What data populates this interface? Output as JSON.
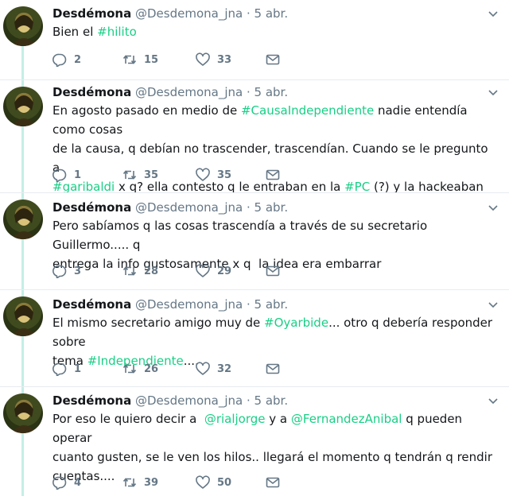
{
  "colors": {
    "accent": "#19cf86",
    "thread_line": "#c4eee6",
    "muted": "#657786"
  },
  "tweets": [
    {
      "name": "Desdémona",
      "handle": "@Desdemona_jna",
      "dot": "·",
      "time": "5 abr.",
      "segments": [
        {
          "t": "Bien el "
        },
        {
          "t": "#hilito",
          "k": "hashtag"
        }
      ],
      "replies": "2",
      "retweets": "15",
      "likes": "33"
    },
    {
      "name": "Desdémona",
      "handle": "@Desdemona_jna",
      "dot": "·",
      "time": "5 abr.",
      "segments": [
        {
          "t": "En agosto pasado en medio de "
        },
        {
          "t": "#CausaIndependiente",
          "k": "hashtag"
        },
        {
          "t": " nadie entendía como cosas\nde la causa, q debían no trascender, trascendían. Cuando se le pregunto a\n"
        },
        {
          "t": "#garibaldi",
          "k": "hashtag"
        },
        {
          "t": " x q? ella contesto q le entraban en la "
        },
        {
          "t": "#PC",
          "k": "hashtag"
        },
        {
          "t": " (?) y la hackeaban"
        }
      ],
      "replies": "1",
      "retweets": "35",
      "likes": "35"
    },
    {
      "name": "Desdémona",
      "handle": "@Desdemona_jna",
      "dot": "·",
      "time": "5 abr.",
      "segments": [
        {
          "t": "Pero sabíamos q las cosas trascendía a través de su secretario Guillermo..... q\nentrega la info gustosamente x q  la idea era embarrar"
        }
      ],
      "replies": "3",
      "retweets": "28",
      "likes": "29"
    },
    {
      "name": "Desdémona",
      "handle": "@Desdemona_jna",
      "dot": "·",
      "time": "5 abr.",
      "segments": [
        {
          "t": "El mismo secretario amigo muy de "
        },
        {
          "t": "#Oyarbide",
          "k": "hashtag"
        },
        {
          "t": "... otro q debería responder sobre\ntema "
        },
        {
          "t": "#Independiente",
          "k": "hashtag"
        },
        {
          "t": "...."
        }
      ],
      "replies": "1",
      "retweets": "26",
      "likes": "32"
    },
    {
      "name": "Desdémona",
      "handle": "@Desdemona_jna",
      "dot": "·",
      "time": "5 abr.",
      "segments": [
        {
          "t": "Por eso le quiero decir a  "
        },
        {
          "t": "@rialjorge",
          "k": "mention"
        },
        {
          "t": " y a "
        },
        {
          "t": "@FernandezAnibal",
          "k": "mention"
        },
        {
          "t": " q pueden operar\ncuanto gusten, se le ven los hilos.. llegará el momento q tendrán q rendir\ncuentas...."
        }
      ],
      "replies": "4",
      "retweets": "39",
      "likes": "50"
    }
  ]
}
